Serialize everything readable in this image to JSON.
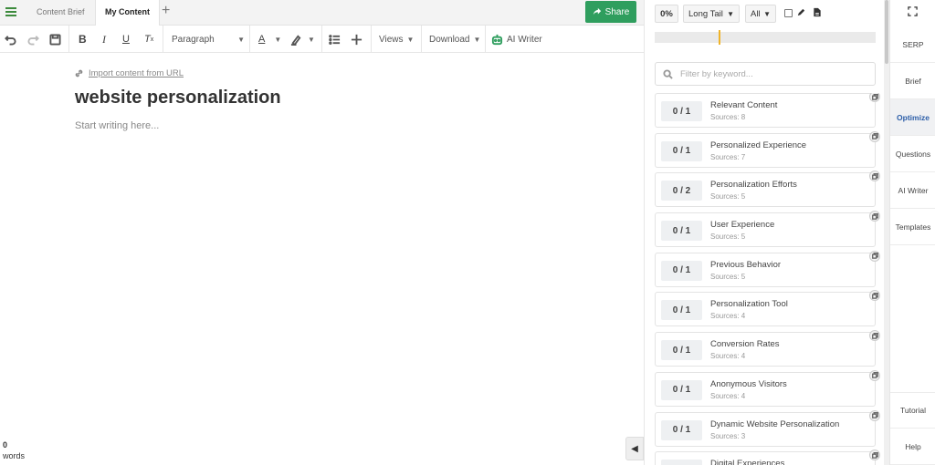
{
  "tabs": [
    "Content Brief",
    "My Content"
  ],
  "share_label": "Share",
  "toolbar": {
    "paragraph_label": "Paragraph",
    "views_label": "Views",
    "download_label": "Download",
    "ai_writer_label": "AI Writer"
  },
  "editor": {
    "import_label": "Import content from URL",
    "title": "website personalization",
    "placeholder": "Start writing here...",
    "word_count": "0",
    "word_label": "words"
  },
  "panel": {
    "score": "0%",
    "term_type": "Long Tail",
    "filter_value": "All",
    "search_placeholder": "Filter by keyword...",
    "keywords": [
      {
        "count": "0 / 1",
        "name": "Relevant Content",
        "sources": "Sources: 8"
      },
      {
        "count": "0 / 1",
        "name": "Personalized Experience",
        "sources": "Sources: 7"
      },
      {
        "count": "0 / 2",
        "name": "Personalization Efforts",
        "sources": "Sources: 5"
      },
      {
        "count": "0 / 1",
        "name": "User Experience",
        "sources": "Sources: 5"
      },
      {
        "count": "0 / 1",
        "name": "Previous Behavior",
        "sources": "Sources: 5"
      },
      {
        "count": "0 / 1",
        "name": "Personalization Tool",
        "sources": "Sources: 4"
      },
      {
        "count": "0 / 1",
        "name": "Conversion Rates",
        "sources": "Sources: 4"
      },
      {
        "count": "0 / 1",
        "name": "Anonymous Visitors",
        "sources": "Sources: 4"
      },
      {
        "count": "0 / 1",
        "name": "Dynamic Website Personalization",
        "sources": "Sources: 3"
      },
      {
        "count": "",
        "name": "Digital Experiences",
        "sources": ""
      }
    ]
  },
  "sidenav": {
    "top_items": [
      "SERP",
      "Brief",
      "Optimize",
      "Questions",
      "AI Writer",
      "Templates"
    ],
    "active": "Optimize",
    "bottom_items": [
      "Tutorial",
      "Help"
    ]
  },
  "colors": {
    "accent_green": "#2f9e5e",
    "active_blue": "#2c5ea8",
    "marker_yellow": "#f0b429"
  }
}
